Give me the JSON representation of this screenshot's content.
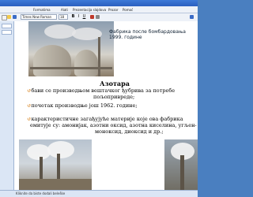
{
  "window": {
    "title": ""
  },
  "menu": {
    "items": [
      "Formatima",
      "Alati",
      "Prezentacija slajdova",
      "Prozor",
      "Pomoć"
    ]
  },
  "toolbar": {
    "font_name": "Times New Roman",
    "font_size": "18"
  },
  "slide": {
    "caption": "Фабрика после бомбардовања 1999. године",
    "heading": "Азотара",
    "bullets": [
      {
        "line1": "бави се производњом вештачког ђубрива за потребе",
        "line2": "пољопривреде;"
      },
      {
        "line1": "почетак производње још 1962. године;",
        "line2": ""
      },
      {
        "line1": "карактеристичне загађујуће материје које ова фабрика",
        "line2": "емитује су: амонијак, азотни оксид, азотна киселина, угљен-",
        "line3": "моноксид, диоксид и др.;"
      }
    ]
  },
  "notes": {
    "placeholder": "Kliknite da biste dodali beleške"
  },
  "icons": [
    "new-icon",
    "open-icon",
    "save-icon",
    "print-icon",
    "bold-icon",
    "italic-icon",
    "underline-icon"
  ]
}
